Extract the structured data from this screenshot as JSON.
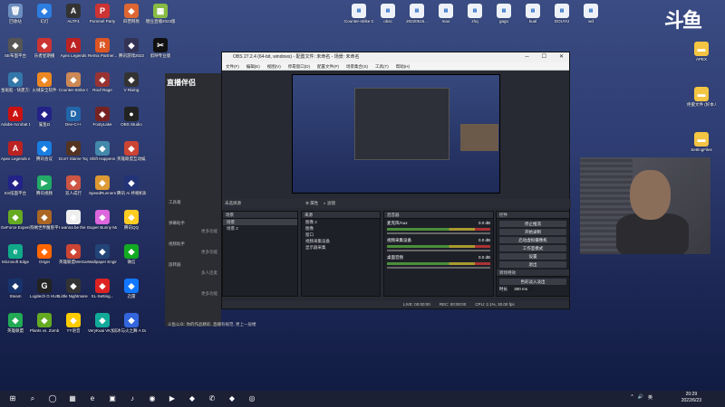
{
  "left_icons": [
    [
      "回收站",
      "🗑",
      "#6c8ebf"
    ],
    [
      "幻灯",
      "◆",
      "#2d7de0"
    ],
    [
      "ALTF4",
      "A",
      "#333"
    ],
    [
      "Pummel Party",
      "P",
      "#c33"
    ],
    [
      "四营网易",
      "◆",
      "#d63"
    ],
    [
      "糖豆直播2023版",
      "▦",
      "#8b4"
    ],
    [
      "SE布面平台",
      "◆",
      "#555"
    ],
    [
      "乐者星期播",
      "◆",
      "#c33"
    ],
    [
      "Apex Legends",
      "A",
      "#b22"
    ],
    [
      "Remix Partner...",
      "R",
      "#d52"
    ],
    [
      "腾讯游戏2022",
      "◆",
      "#335"
    ],
    [
      "剪映专业版",
      "✂",
      "#111"
    ],
    [
      "金斑船 - 快建方式",
      "◆",
      "#37a"
    ],
    [
      "火绒安全软件",
      "◆",
      "#e82"
    ],
    [
      "Counter-Strike Global Of...",
      "◆",
      "#c85"
    ],
    [
      "Roof Rage",
      "◆",
      "#933"
    ],
    [
      "V Rising",
      "◆",
      "#333"
    ],
    [
      "",
      "",
      ""
    ],
    [
      "Adobe Acrobat DC",
      "A",
      "#c11"
    ],
    [
      "鲨鱼Ω",
      "◆",
      "#228"
    ],
    [
      "Dev-C++",
      "D",
      "#26a"
    ],
    [
      "FootyLake",
      "◆",
      "#722"
    ],
    [
      "OBS Studio",
      "●",
      "#222"
    ],
    [
      "",
      "",
      ""
    ],
    [
      "Apex Legends en",
      "A",
      "#b22"
    ],
    [
      "腾讯会议",
      "◆",
      "#1a7de0"
    ],
    [
      "Don't Starve Together",
      "◆",
      "#532"
    ],
    [
      "Shift Happens",
      "◆",
      "#48a"
    ],
    [
      "英雄联盟互动娱乐",
      "◆",
      "#c43"
    ],
    [
      "",
      "",
      ""
    ],
    [
      "ES炫面平台",
      "◆",
      "#228"
    ],
    [
      "腾讯视频",
      "▶",
      "#2a6"
    ],
    [
      "双人成行",
      "◆",
      "#c54"
    ],
    [
      "SpeedRunners",
      "◆",
      "#d93"
    ],
    [
      "腾讯 Ai 终端机助手",
      "◆",
      "#237"
    ],
    [
      "",
      "",
      ""
    ],
    [
      "GeForce Experience",
      "◆",
      "#6a2"
    ],
    [
      "狗贼世界魔兽平台",
      "◆",
      "#a62"
    ],
    [
      "I wanna be the Creator",
      "◆",
      "#eee"
    ],
    [
      "Super Bunny Man",
      "◆",
      "#d6d"
    ],
    [
      "腾讯QQ",
      "◆",
      "#fc2"
    ],
    [
      "",
      "",
      ""
    ],
    [
      "Microsoft Edge",
      "e",
      "#1a8"
    ],
    [
      "Origin",
      "◆",
      "#f60"
    ],
    [
      "英雄联盟WeGame版",
      "◆",
      "#c43"
    ],
    [
      "Wallpaper Engine:...",
      "◆",
      "#247"
    ],
    [
      "微信",
      "◆",
      "#1a2"
    ],
    [
      "",
      "",
      ""
    ],
    [
      "Steam",
      "◆",
      "#17336b"
    ],
    [
      "Logitech G HUB",
      "G",
      "#222"
    ],
    [
      "Little Nightmares",
      "◆",
      "#333"
    ],
    [
      "XL-Setting...",
      "◆",
      "#d22"
    ],
    [
      "迅雷",
      "◆",
      "#17f"
    ],
    [
      "",
      "",
      ""
    ],
    [
      "英雄联盟",
      "◆",
      "#2a5"
    ],
    [
      "Plants vs. Zombies G...",
      "◆",
      "#6a2"
    ],
    [
      "YY语音",
      "◆",
      "#fc0"
    ],
    [
      "VeryKuai VK加速器",
      "◆",
      "#1a9"
    ],
    [
      "冰与火之舞 A Dance of F...",
      "◆",
      "#36d"
    ],
    [
      "",
      "",
      ""
    ]
  ],
  "top_files": [
    "Counter-strike Global Of...",
    "obsc",
    "20220516...",
    "mao",
    "zhq",
    "gago",
    "kual",
    "DOUYU",
    "wd"
  ],
  "right_files": [
    "APEX",
    "绝蜜文件 (好本人模吗)",
    "SettingFiles",
    "nas大作业"
  ],
  "brand": "斗鱼",
  "obs": {
    "title": "OBS 27.2.4 (64-bit, windows) - 配置文件: 未命名 - 场景: 未命名",
    "menu": [
      "文件(F)",
      "编辑(E)",
      "视图(V)",
      "停靠窗口(D)",
      "配置文件(P)",
      "场景集合(S)",
      "工具(T)",
      "帮助(H)"
    ],
    "no_source": "未选择源",
    "props_label": "属性",
    "filters_label": "滤镜",
    "scenes_header": "场景",
    "scenes": [
      "场景",
      "场景 2"
    ],
    "sources_header": "来源",
    "sources": [
      "图像 2",
      "图像",
      "窗口",
      "视频采集设备",
      "显示器采集"
    ],
    "mixer_header": "混音器",
    "mixer": [
      {
        "name": "麦克风/Aux",
        "db": "0.0 dB"
      },
      {
        "name": "视频采集设备",
        "db": "0.0 dB"
      },
      {
        "name": "桌面音频",
        "db": "0.0 dB"
      }
    ],
    "controls_header": "控件",
    "controls": [
      "停止推流",
      "开始录制",
      "启动虚拟摄像机",
      "工作室模式",
      "设置",
      "退出"
    ],
    "transition_header": "转场特效",
    "transition": "色彩淡入淡出",
    "duration_label": "时长",
    "duration": "300 ms",
    "status": [
      "LIVE: 00:00:00",
      "REC: 00:00:00",
      "CPU: 2.1%, 30.00 fps"
    ]
  },
  "douyu": {
    "logo": "直播伴侣",
    "side": [
      "工具箱",
      "弹幕助手",
      "视频助手",
      "旋转器"
    ],
    "sideb": [
      "更多功能",
      "更多功能",
      "多人连麦",
      "更多功能"
    ],
    "bottom": "斗鱼公众: 你的作品精彩, 直播有规范, 更上一层楼"
  },
  "taskbar": {
    "icons": [
      "⊞",
      "⌕",
      "◯",
      "▦",
      "e",
      "▣",
      "♪",
      "◉",
      "▶",
      "◆",
      "✆",
      "◆",
      "◎"
    ],
    "tray": [
      "^",
      "🔊",
      "英"
    ],
    "time": "20:29",
    "date": "2022/6/23"
  }
}
